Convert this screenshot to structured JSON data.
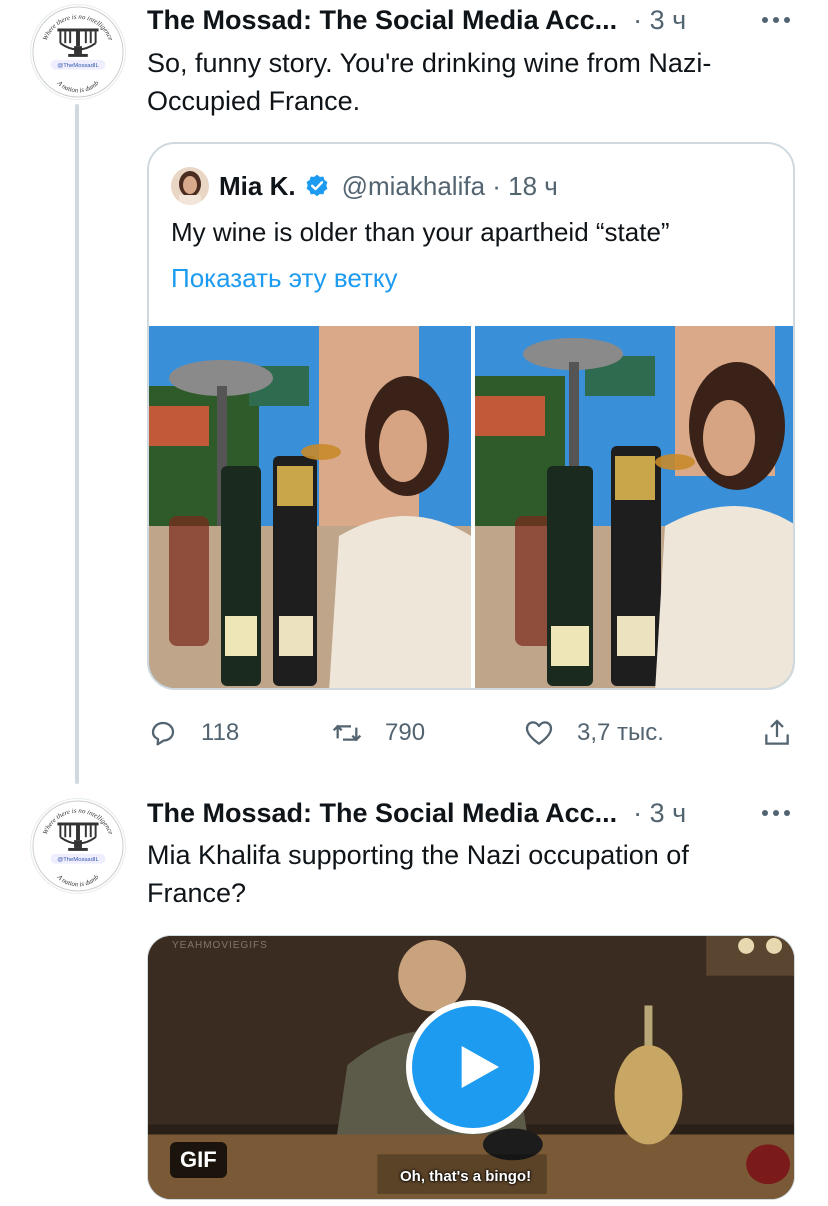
{
  "tweets": [
    {
      "author": "The Mossad: The Social Media Acc...",
      "time": "· 3 ч",
      "text": "So, funny story. You're drinking wine from Nazi-Occupied France.",
      "quote": {
        "name": "Mia K.",
        "handle": "@miakhalifa · 18 ч",
        "text": "My wine is older than your apartheid “state”",
        "show_thread": "Показать эту ветку"
      },
      "actions": {
        "replies": "118",
        "retweets": "790",
        "likes": "3,7 тыс."
      }
    },
    {
      "author": "The Mossad: The Social Media Acc...",
      "time": "· 3 ч",
      "text": "Mia Khalifa supporting the Nazi occupation of France?",
      "media": {
        "badge": "GIF",
        "subtitle": "Oh, that's a bingo!",
        "watermark": "YEAHMOVIEGIFS"
      }
    }
  ],
  "avatar_seal": {
    "top_text": "Where there is no intelligence",
    "middle_text": "@TheMossadIL",
    "bottom_text": "A nation is dumb"
  },
  "colors": {
    "accent": "#1d9bf0",
    "secondary_text": "#536471",
    "thread_line": "#cfd9de"
  }
}
